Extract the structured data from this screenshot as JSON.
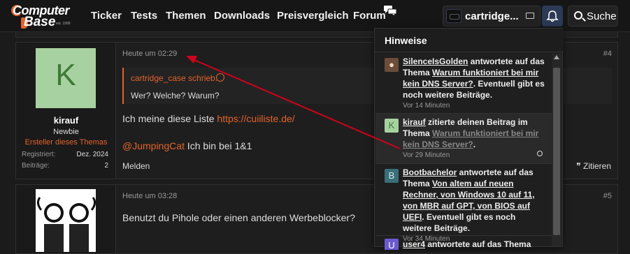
{
  "header": {
    "logo_line1": "Computer",
    "logo_line2": "Base",
    "logo_est": "est. 1999",
    "nav": [
      "Ticker",
      "Tests",
      "Themen",
      "Downloads",
      "Preisvergleich",
      "Forum"
    ],
    "username": "cartridge...",
    "search_label": "Suche"
  },
  "post1": {
    "avatar_letter": "K",
    "author": "kirauf",
    "role": "Newbie",
    "badge": "Ersteller dieses Themas",
    "registered_label": "Registriert:",
    "registered_value": "Dez. 2024",
    "posts_label": "Beiträge:",
    "posts_value": "2",
    "time": "Heute um 02:29",
    "number": "#4",
    "quote_author": "cartridge_case schrieb:",
    "quote_text": "Wer? Welche? Warum?",
    "line1_text": "Ich meine diese Liste ",
    "line1_link": "https://cuiiliste.de/",
    "mention": "@JumpingCat",
    "line2_text": " Ich bin bei 1&1",
    "report_label": "Melden",
    "quote_label": "Zitieren"
  },
  "post2": {
    "time": "Heute um 03:28",
    "number": "#5",
    "text": "Benutzt du Pihole oder einen anderen Werbeblocker?"
  },
  "notifications": {
    "title": "Hinweise",
    "items": [
      {
        "user": "SilenceIsGolden",
        "action": " antwortete auf das Thema ",
        "thread": "Warum funktioniert bei mir kein DNS Server?",
        "suffix": ". Eventuell gibt es noch weitere Beiträge.",
        "time": "Vor 14 Minuten"
      },
      {
        "user": "kirauf",
        "action": " zitierte deinen Beitrag im Thema ",
        "thread": "Warum funktioniert bei mir kein DNS Server?",
        "suffix": ".",
        "time": "Vor 29 Minuten",
        "avatar_letter": "K"
      },
      {
        "user": "Bootbachelor",
        "action": " antwortete auf das Thema ",
        "thread": "Von altem auf neuen Rechner, von Windows 10 auf 11, von MBR auf GPT, von BIOS auf UEFI",
        "suffix": ". Eventuell gibt es noch weitere Beiträge.",
        "time": "Vor 34 Minuten",
        "avatar_letter": "B"
      },
      {
        "user": "user4",
        "action": " antwortete auf das Thema",
        "avatar_letter": "U"
      }
    ]
  },
  "colors": {
    "accent": "#e2632c",
    "annotation_arrow": "#d0021b",
    "avatar_k_bg": "#a7d1a0"
  }
}
